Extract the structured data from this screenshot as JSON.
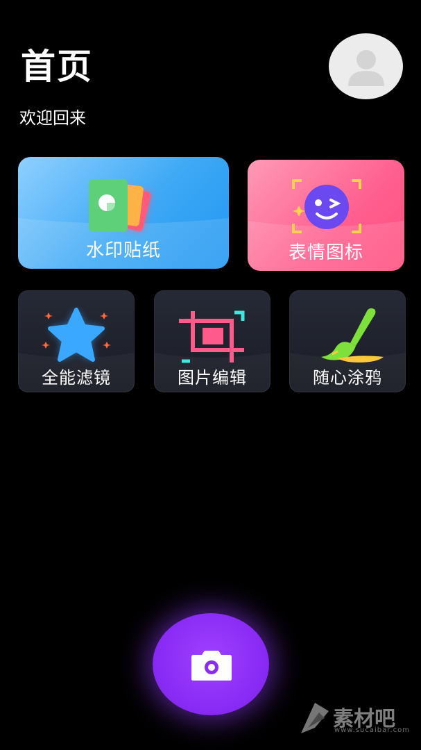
{
  "header": {
    "title": "首页",
    "subtitle": "欢迎回来"
  },
  "cards": {
    "watermark_sticker": "水印贴纸",
    "emoji_icons": "表情图标",
    "all_filters": "全能滤镜",
    "image_edit": "图片编辑",
    "doodle": "随心涂鸦"
  },
  "icons": {
    "avatar": "user-avatar-icon",
    "watermark_sticker": "sticker-cards-icon",
    "emoji_icons": "wink-face-icon",
    "all_filters": "star-icon",
    "image_edit": "crop-icon",
    "doodle": "paintbrush-icon",
    "camera": "camera-icon"
  },
  "colors": {
    "background": "#000000",
    "watermark_card": "#3ea9f5",
    "emoji_card": "#ff5f8f",
    "small_card": "#1f222c",
    "camera_button": "#8a2cf5"
  },
  "watermark": {
    "text": "素材吧",
    "url": "www.sucaibar.com"
  }
}
